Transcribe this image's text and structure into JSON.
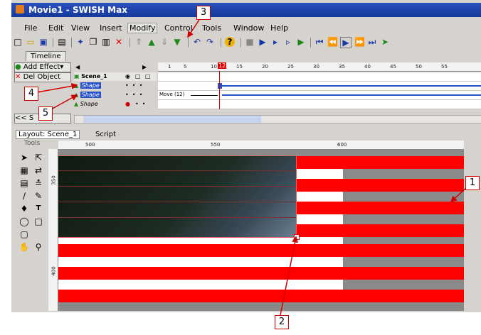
{
  "window": {
    "title": "Movie1 - SWISH Max"
  },
  "menu": [
    "File",
    "Edit",
    "View",
    "Insert",
    "Modify",
    "Control",
    "Tools",
    "Window",
    "Help"
  ],
  "timeline": {
    "tab": "Timeline",
    "add_effect": "Add Effect▾",
    "del_object": "Del Object",
    "scene": "Scene_1",
    "objects": [
      "Shape",
      "Shape",
      "Shape"
    ],
    "frame_marker": "12",
    "frame_ticks": [
      "1",
      "5",
      "10",
      "12",
      "15",
      "20",
      "25",
      "30",
      "35",
      "40",
      "45",
      "50",
      "55"
    ],
    "move_label": "Move (12)",
    "scene_nav": "<< S"
  },
  "layout": {
    "tab_layout": "Layout: Scene_1",
    "tab_script": "Script",
    "tools_label": "Tools",
    "ruler_x": [
      "500",
      "550",
      "600"
    ],
    "ruler_y": [
      "350",
      "400"
    ]
  },
  "callouts": [
    "1",
    "2",
    "3",
    "4",
    "5"
  ],
  "colors": {
    "stripe_red": "#ff0000",
    "stripe_white": "#ffffff",
    "accent_blue": "#2450c8"
  }
}
